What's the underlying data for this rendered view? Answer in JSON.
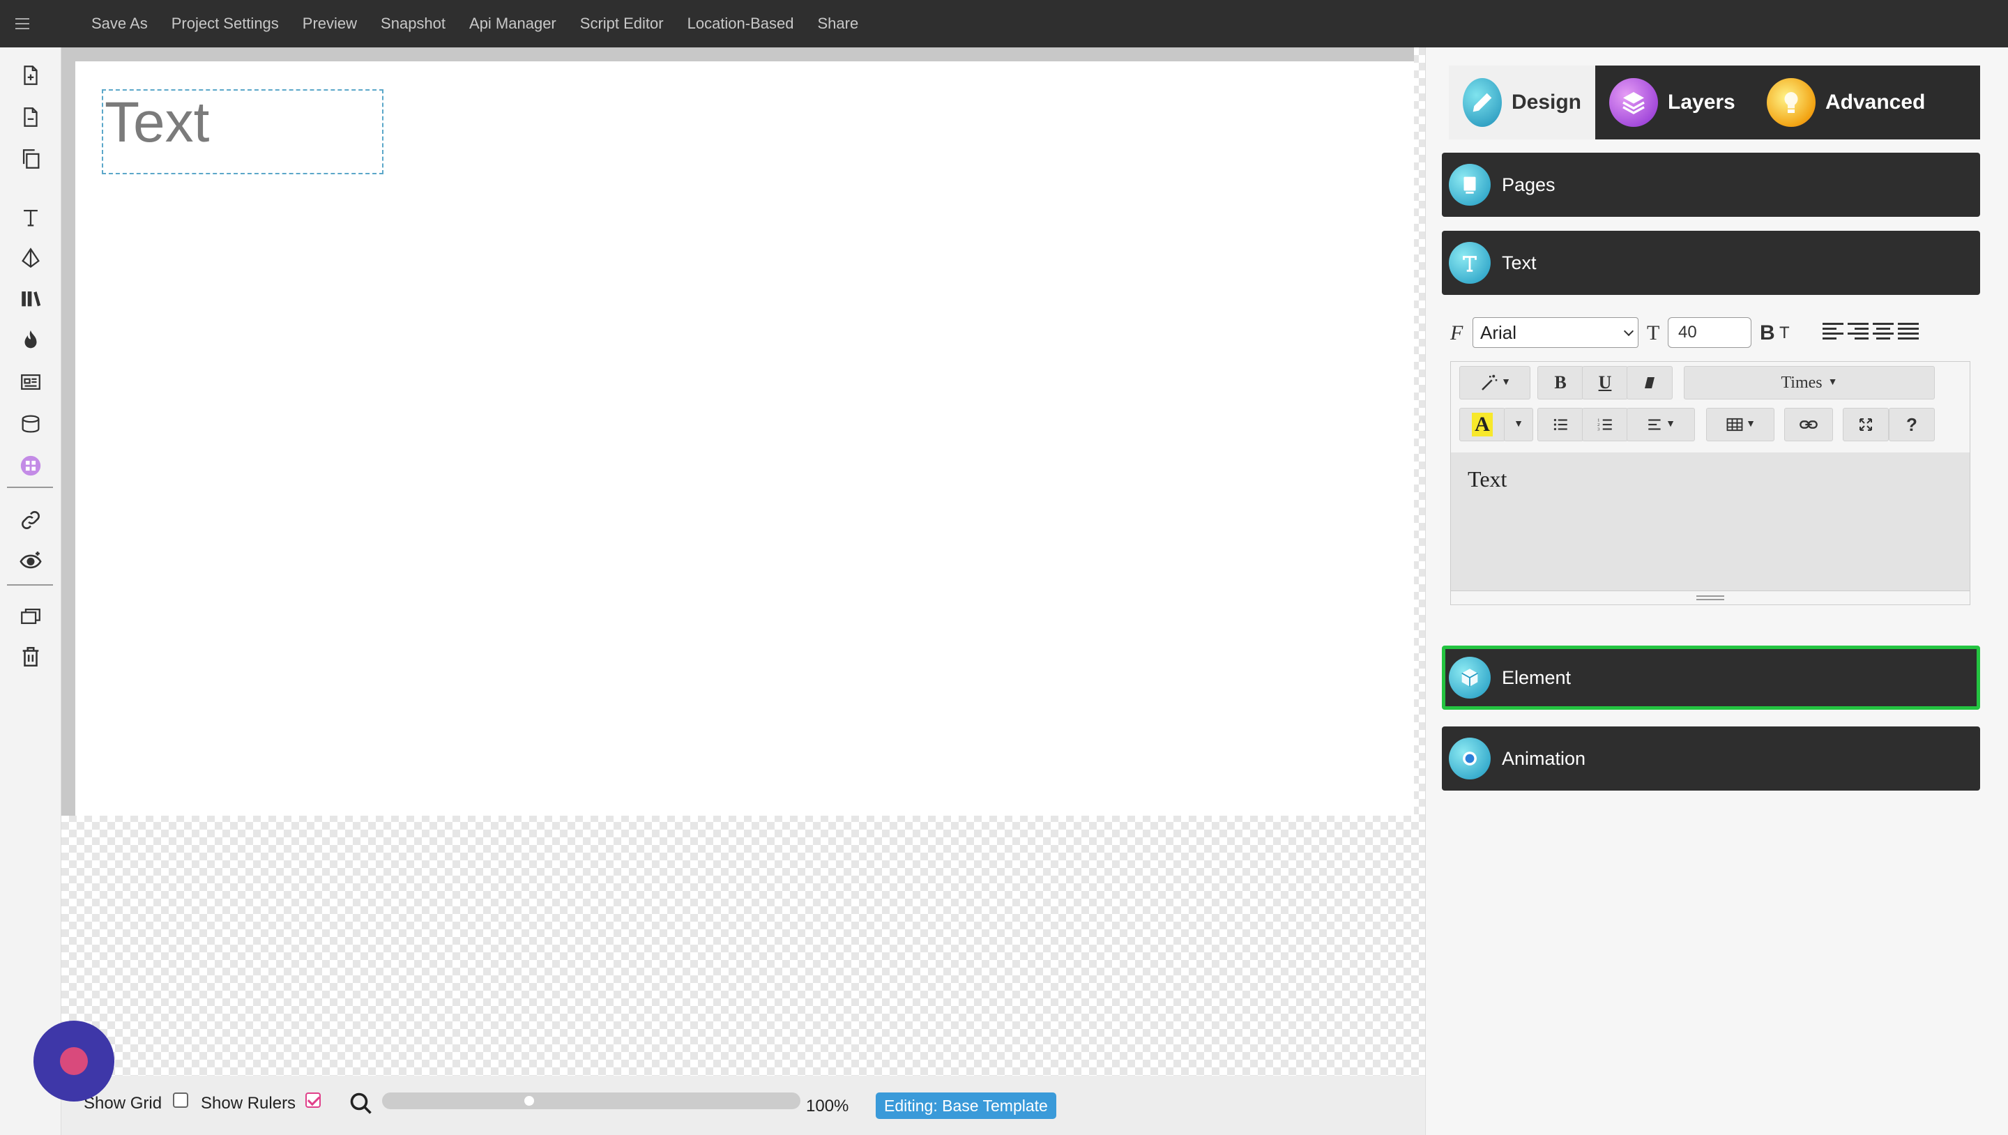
{
  "menu": {
    "items": [
      "Save As",
      "Project Settings",
      "Preview",
      "Snapshot",
      "Api Manager",
      "Script Editor",
      "Location-Based",
      "Share"
    ]
  },
  "canvas": {
    "text_element": "Text"
  },
  "bottom_bar": {
    "show_grid_label": "Show Grid",
    "show_grid_checked": false,
    "show_rulers_label": "Show Rulers",
    "show_rulers_checked": true,
    "zoom_level": "100%",
    "editing_badge": "Editing: Base Template"
  },
  "right_panel": {
    "tabs": [
      {
        "label": "Design",
        "icon": "pencil-icon",
        "active": true
      },
      {
        "label": "Layers",
        "icon": "layers-icon",
        "active": false
      },
      {
        "label": "Advanced",
        "icon": "lightbulb-icon",
        "active": false
      }
    ],
    "sections": {
      "pages": "Pages",
      "text": "Text",
      "element": "Element",
      "animation": "Animation"
    },
    "text_format": {
      "font": "Arial",
      "size": "40"
    },
    "editor": {
      "font_dropdown": "Times",
      "content": "Text",
      "help": "?"
    }
  },
  "colors": {
    "topbar": "#2f2f2f",
    "accent_green": "#24c441",
    "badge_blue": "#3a9ad9",
    "fab": "#3e37a8"
  }
}
